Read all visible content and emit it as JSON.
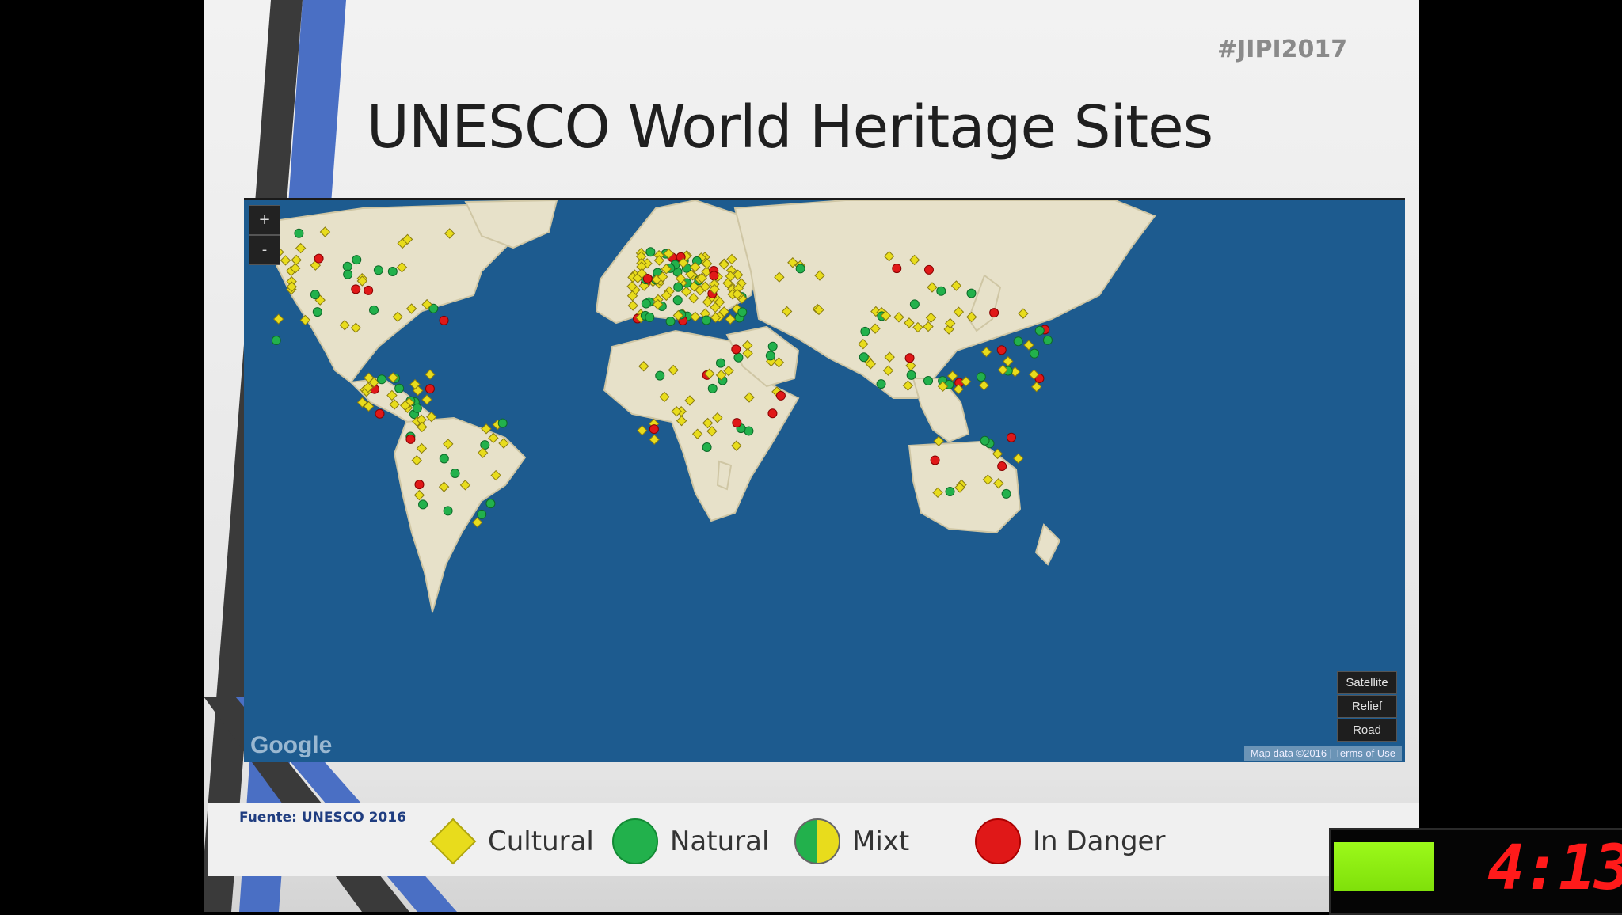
{
  "slide": {
    "hashtag": "#JIPI2017",
    "title": "UNESCO World Heritage Sites",
    "source": "Fuente: UNESCO 2016"
  },
  "map": {
    "zoom_in_label": "+",
    "zoom_out_label": "-",
    "map_types": [
      "Satellite",
      "Relief",
      "Road"
    ],
    "logo": "Google",
    "attribution": "Map data ©2016 | Terms of Use",
    "ocean_color": "#1d5b8f",
    "land_color": "#e7e1c9"
  },
  "legend": [
    {
      "label": "Cultural",
      "icon": "yellow-diamond-icon",
      "color": "#e8dc1c"
    },
    {
      "label": "Natural",
      "icon": "green-circle-icon",
      "color": "#22b14c"
    },
    {
      "label": "Mixt",
      "icon": "half-green-half-yellow-circle-icon",
      "color": "#e8dc1c"
    },
    {
      "label": "In Danger",
      "icon": "red-circle-icon",
      "color": "#e01818"
    }
  ],
  "timer": {
    "display": "4:13",
    "bar_color": "#8ef012",
    "digit_color": "#ff1a1a"
  }
}
